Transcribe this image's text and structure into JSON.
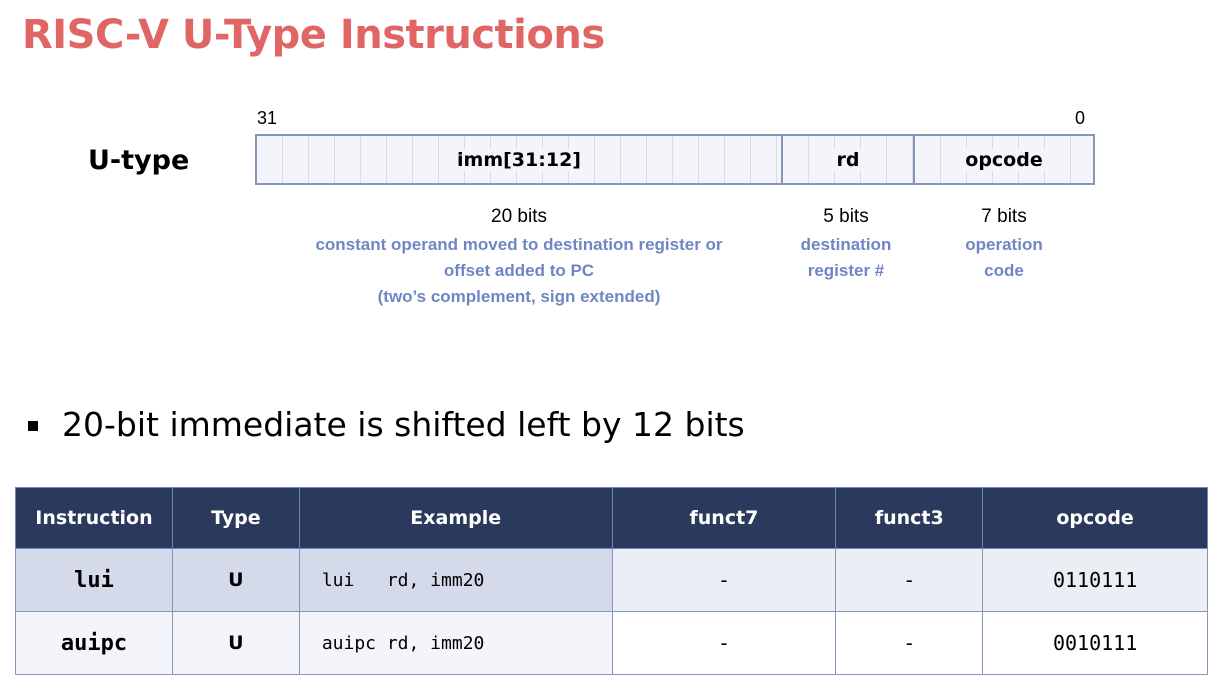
{
  "title": "RISC-V U-Type Instructions",
  "format": {
    "label": "U-type",
    "high_bit": "31",
    "low_bit": "0",
    "fields": [
      {
        "name": "imm[31:12]",
        "bits": "20 bits",
        "desc": [
          "constant operand moved to destination register or",
          "offset added to PC",
          "(two’s complement, sign extended)"
        ]
      },
      {
        "name": "rd",
        "bits": "5 bits",
        "desc": [
          "destination",
          "register #"
        ]
      },
      {
        "name": "opcode",
        "bits": "7 bits",
        "desc": [
          "operation",
          "code"
        ]
      }
    ]
  },
  "bullet": "20-bit immediate is shifted left by 12 bits",
  "table": {
    "headers": [
      "Instruction",
      "Type",
      "Example",
      "funct7",
      "funct3",
      "opcode"
    ],
    "rows": [
      [
        "lui",
        "U",
        "lui   rd, imm20",
        "-",
        "-",
        "0110111"
      ],
      [
        "auipc",
        "U",
        "auipc rd, imm20",
        "-",
        "-",
        "0010111"
      ]
    ]
  },
  "colors": {
    "title": "#e06666",
    "header_bg": "#2b3a5c",
    "note": "#6f86c4",
    "border": "#8497b8"
  }
}
